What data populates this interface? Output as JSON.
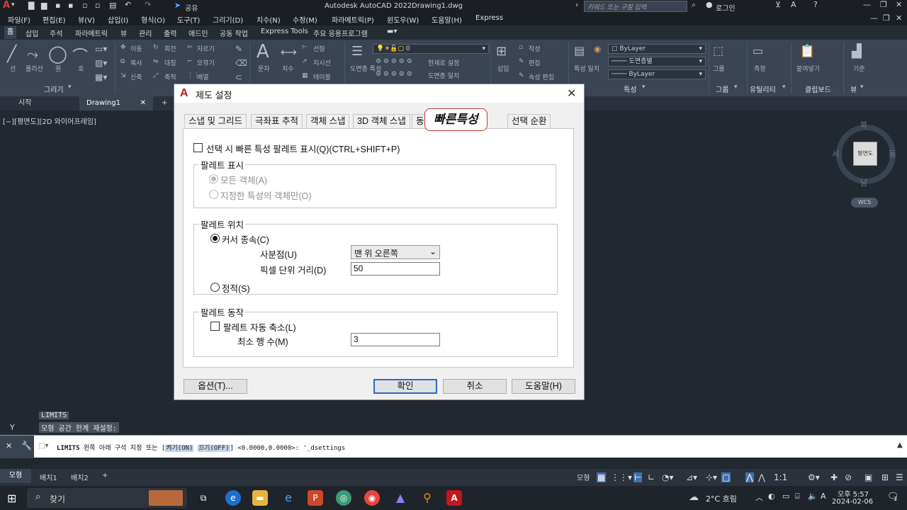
{
  "app": {
    "title": "Autodesk AutoCAD 2022",
    "document": "Drawing1.dwg",
    "share_label": "공유",
    "search_placeholder": "키워드 또는 구절 입력",
    "login_label": "로그인"
  },
  "menu": [
    "파일(F)",
    "편집(E)",
    "뷰(V)",
    "삽입(I)",
    "형식(O)",
    "도구(T)",
    "그리기(D)",
    "치수(N)",
    "수정(M)",
    "파라메트릭(P)",
    "윈도우(W)",
    "도움말(H)",
    "Express"
  ],
  "ribbon_tabs": [
    "홈",
    "삽입",
    "주석",
    "파라메트릭",
    "뷰",
    "관리",
    "출력",
    "애드인",
    "공동 작업",
    "Express Tools",
    "주요 응용프로그램"
  ],
  "ribbon": {
    "draw_tools": [
      "선",
      "폴리선",
      "원",
      "호"
    ],
    "modify_tools": [
      "이동",
      "회전",
      "자르기",
      "복사",
      "대칭",
      "모깎기",
      "신축",
      "축척",
      "배열"
    ],
    "annotation_tools": [
      "문자",
      "치수",
      "선형",
      "지시선",
      "테이블"
    ],
    "layer_tools": [
      "도면층 특성",
      "현재로 설정",
      "도면층 일치"
    ],
    "layer_value": "0",
    "block_tools": [
      "삽입",
      "작성",
      "편집",
      "속성 편집"
    ],
    "property_tools": [
      "특성 일치"
    ],
    "group_tools": [
      "그룹"
    ],
    "utility_tools": [
      "측정"
    ],
    "clipboard_tools": [
      "붙여넣기"
    ],
    "base_tools": [
      "기준"
    ],
    "bylayer1": "ByLayer",
    "bylayer2": "도면층별",
    "bylayer3": "ByLayer",
    "groups": [
      "그리기",
      "특성",
      "그룹",
      "유틸리티",
      "클립보드",
      "뷰"
    ]
  },
  "file_tabs": [
    "시작",
    "Drawing1"
  ],
  "viewport_label": "[−][평면도][2D 와이어프레임]",
  "viewcube": {
    "face": "평면도",
    "north": "북",
    "south": "남",
    "east": "동",
    "west": "서",
    "wcs": "WCS"
  },
  "history": [
    "LIMITS",
    "모형 공간 한계 재설정:"
  ],
  "command": {
    "name": "LIMITS",
    "prompt": "왼쪽 아래 구석 지정 또는 [",
    "opt_on": "켜기(ON)",
    "opt_off": "끄기(OFF)",
    "rest": "] <0.0000,0.0000>: '_dsettings"
  },
  "ucs_axis": "Y",
  "layout_tabs": [
    "모형",
    "배치1",
    "배치2"
  ],
  "status": {
    "model": "모형",
    "scale": "1:1"
  },
  "taskbar": {
    "search": "찾기",
    "weather": "2°C  흐림",
    "time": "오후 5:57",
    "date": "2024-02-06",
    "notifications": "3"
  },
  "dialog": {
    "title": "제도 설정",
    "tabs": [
      "스냅 및 그리드",
      "극좌표 추적",
      "객체 스냅",
      "3D 객체 스냅",
      "동",
      "빠른특성",
      "선택 순환"
    ],
    "show_palette_checkbox": "선택 시 빠른 특성 팔레트 표시(Q)(CTRL+SHIFT+P)",
    "palette_display": {
      "legend": "팔레트 표시",
      "all_objects": "모든 객체(A)",
      "specified_only": "지정한 특성의 객체만(O)"
    },
    "palette_location": {
      "legend": "팔레트 위치",
      "cursor_dependent": "커서 종속(C)",
      "quadrant_label": "사분점(U)",
      "quadrant_value": "맨 위 오른쪽",
      "distance_label": "픽셀 단위 거리(D)",
      "distance_value": "50",
      "static": "정적(S)"
    },
    "palette_behavior": {
      "legend": "팔레트 동작",
      "auto_collapse": "팔레트 자동 축소(L)",
      "min_rows_label": "최소 행 수(M)",
      "min_rows_value": "3"
    },
    "buttons": {
      "options": "옵션(T)...",
      "ok": "확인",
      "cancel": "취소",
      "help": "도움말(H)"
    }
  }
}
